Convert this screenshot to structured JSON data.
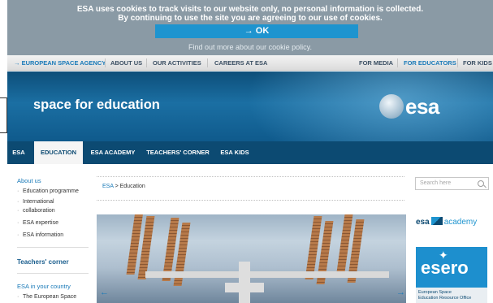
{
  "cookie_banner": {
    "line1": "ESA uses cookies to track visits to our website only, no personal information is collected.",
    "line2": "By continuing to use the site you are agreeing to our use of cookies.",
    "ok_label": "→ OK",
    "more_link": "Find out more about our cookie policy."
  },
  "top_nav": {
    "european_space_agency": "→ EUROPEAN SPACE AGENCY",
    "about_us": "ABOUT US",
    "our_activities": "OUR ACTIVITIES",
    "careers": "CAREERS AT ESA",
    "for_media": "FOR MEDIA",
    "for_educators": "FOR EDUCATORS",
    "for_kids": "FOR KIDS"
  },
  "header": {
    "title": "space for education",
    "logo_text": "esa"
  },
  "tabs": [
    "ESA",
    "EDUCATION",
    "ESA ACADEMY",
    "TEACHERS' CORNER",
    "ESA KIDS"
  ],
  "sidebar": {
    "about_us": "About us",
    "items": [
      "Education programme",
      "International",
      "collaboration",
      "ESA expertise",
      "ESA information"
    ],
    "teachers_corner": "Teachers' corner",
    "esa_in_country": "ESA in your country",
    "country_item": "The European Space"
  },
  "breadcrumb": {
    "root": "ESA",
    "separator": ">",
    "current": "Education"
  },
  "search": {
    "placeholder": "Search here"
  },
  "academy": {
    "part1": "esa",
    "part2": "academy"
  },
  "esero": {
    "word": "esero",
    "sub_line1": "European Space",
    "sub_line2": "Education Resource Office"
  },
  "carousel": {
    "prev": "←",
    "next": "→"
  },
  "colors": {
    "cookie_bg": "#8a9aa5",
    "ok_button": "#1e94cf",
    "header_blue": "#1b6fa3",
    "tab_bar": "#0c4a72",
    "link_blue": "#1a7ab8"
  }
}
